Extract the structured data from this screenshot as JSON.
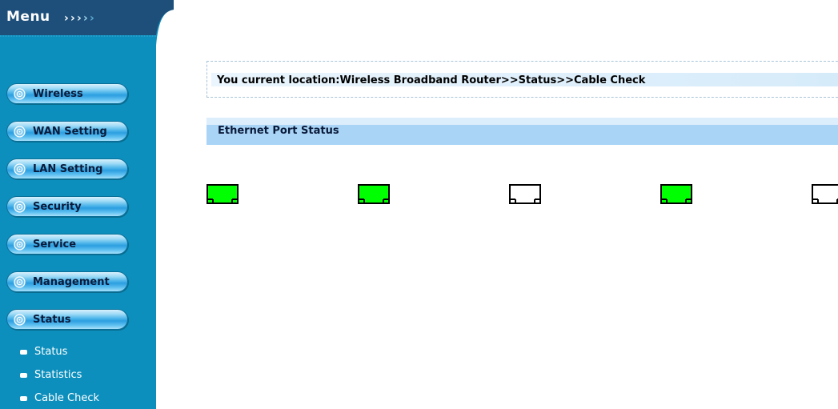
{
  "menu": {
    "title": "Menu",
    "arrows_icon": "double-chevron-right-icon"
  },
  "nav": {
    "items": [
      {
        "label": "Wireless"
      },
      {
        "label": "WAN Setting"
      },
      {
        "label": "LAN Setting"
      },
      {
        "label": "Security"
      },
      {
        "label": "Service"
      },
      {
        "label": "Management"
      },
      {
        "label": "Status"
      }
    ],
    "bullet_icon": "target-circle-icon"
  },
  "submenu": {
    "items": [
      {
        "label": "Status"
      },
      {
        "label": "Statistics"
      },
      {
        "label": "Cable Check"
      }
    ],
    "bullet_icon": "rounded-dash-icon"
  },
  "location": {
    "text": "You current location:Wireless Broadband Router>>Status>>Cable Check"
  },
  "section": {
    "title": "Ethernet Port Status"
  },
  "ports": [
    {
      "status": "connected"
    },
    {
      "status": "connected"
    },
    {
      "status": "disconnected"
    },
    {
      "status": "connected"
    },
    {
      "status": "disconnected"
    }
  ],
  "colors": {
    "sidebar": "#0d8fbd",
    "port_connected": "#00ff00",
    "port_disconnected": "#ffffff",
    "section_bar": "#a9d4f5"
  }
}
